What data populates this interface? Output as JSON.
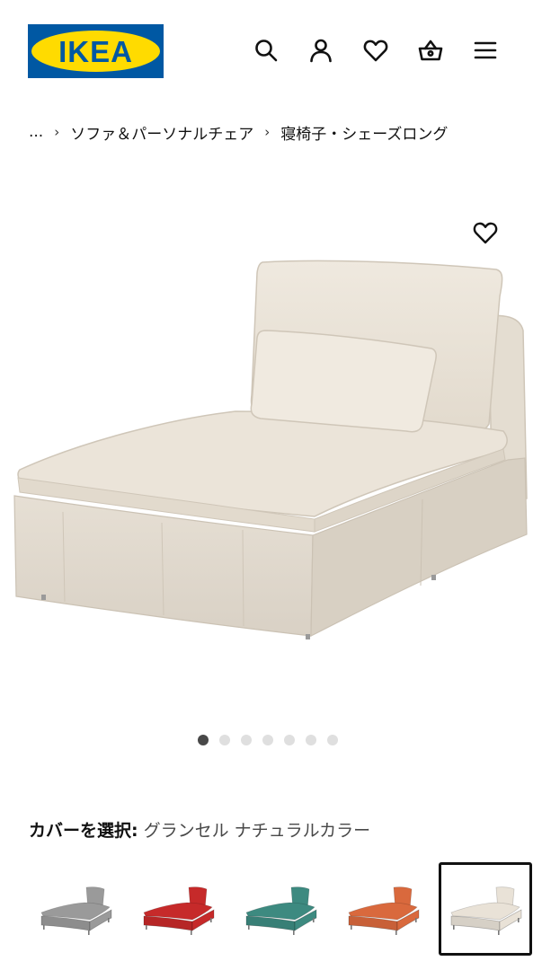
{
  "header": {
    "logo_text": "IKEA",
    "icons": [
      "search-icon",
      "user-icon",
      "heart-icon",
      "cart-icon",
      "menu-icon"
    ]
  },
  "breadcrumb": {
    "ellipsis": "...",
    "separator": "›",
    "items": [
      "ソファ＆パーソナルチェア",
      "寝椅子・シェーズロング"
    ]
  },
  "gallery": {
    "dots_total": 7,
    "active_dot": 1
  },
  "product_image": {
    "fabric_color": "#e9e2d7"
  },
  "cover": {
    "label": "カバーを選択:",
    "value": "グランセル ナチュラルカラー"
  },
  "swatches": [
    {
      "color": "#9a9a9a"
    },
    {
      "color": "#c62a2a"
    },
    {
      "color": "#3d8a80"
    },
    {
      "color": "#d9693d"
    },
    {
      "color": "#e9e2d7",
      "selected": true
    }
  ]
}
